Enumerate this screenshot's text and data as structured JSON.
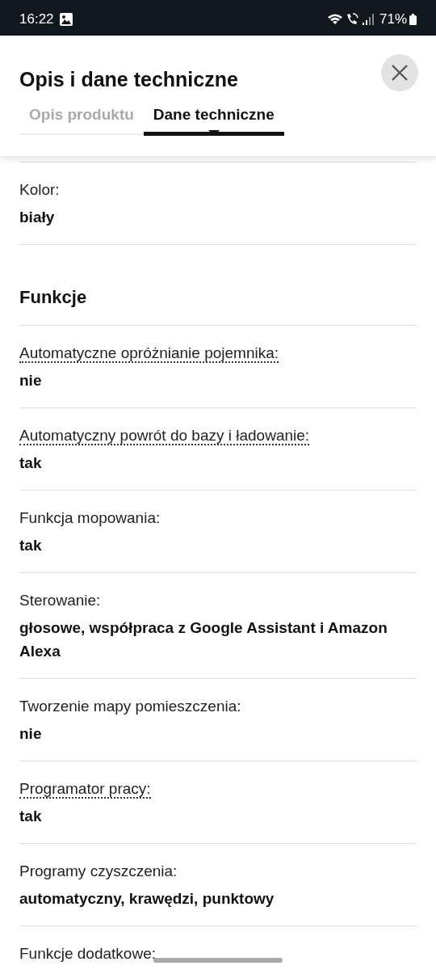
{
  "status_bar": {
    "time": "16:22",
    "battery": "71%"
  },
  "sheet": {
    "title": "Opis i dane techniczne"
  },
  "tabs": [
    {
      "label": "Opis produktu",
      "selected": false
    },
    {
      "label": "Dane techniczne",
      "selected": true
    }
  ],
  "specs": [
    {
      "kind": "row",
      "label": "Kolor:",
      "value": "biały",
      "hint": false
    },
    {
      "kind": "heading",
      "label": "Funkcje"
    },
    {
      "kind": "row",
      "label": "Automatyczne opróżnianie pojemnika:",
      "value": "nie",
      "hint": true
    },
    {
      "kind": "row",
      "label": "Automatyczny powrót do bazy i ładowanie:",
      "value": "tak",
      "hint": true
    },
    {
      "kind": "row",
      "label": "Funkcja mopowania:",
      "value": "tak",
      "hint": false
    },
    {
      "kind": "row",
      "label": "Sterowanie:",
      "value": "głosowe, współpraca z Google Assistant i Amazon Alexa",
      "hint": false
    },
    {
      "kind": "row",
      "label": "Tworzenie mapy pomieszczenia:",
      "value": "nie",
      "hint": false
    },
    {
      "kind": "row",
      "label": "Programator pracy:",
      "value": "tak",
      "hint": true
    },
    {
      "kind": "row",
      "label": "Programy czyszczenia:",
      "value": "automatyczny, krawędzi, punktowy",
      "hint": false
    },
    {
      "kind": "row",
      "label": "Funkcje dodatkowe:",
      "hint": false
    }
  ]
}
